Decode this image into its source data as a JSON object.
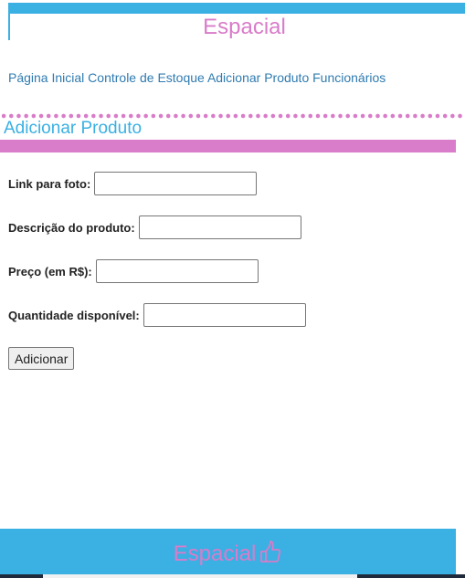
{
  "header": {
    "title": "Espacial"
  },
  "nav": {
    "items": [
      {
        "label": "Página Inicial"
      },
      {
        "label": "Controle de Estoque"
      },
      {
        "label": "Adicionar Produto"
      },
      {
        "label": "Funcionários"
      }
    ]
  },
  "section": {
    "title": "Adicionar Produto"
  },
  "form": {
    "photo_label": "Link para foto:",
    "photo_value": "",
    "description_label": "Descrição do produto:",
    "description_value": "",
    "price_label": "Preço (em R$):",
    "price_value": "",
    "quantity_label": "Quantidade disponível:",
    "quantity_value": "",
    "submit_label": "Adicionar"
  },
  "footer": {
    "title": "Espacial",
    "icon": "thumbs-up-icon"
  },
  "colors": {
    "blue": "#3ab0e3",
    "pink": "#d97cc9",
    "link": "#2f7bb0"
  }
}
